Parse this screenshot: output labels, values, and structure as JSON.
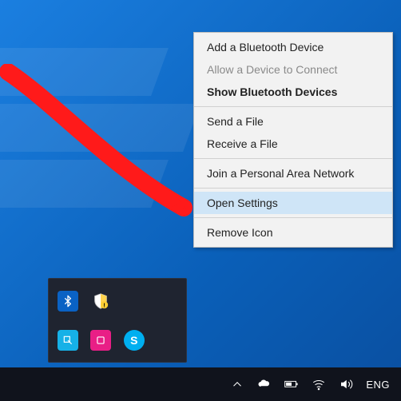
{
  "menu": {
    "add_device": "Add a Bluetooth Device",
    "allow_connect": "Allow a Device to Connect",
    "show_devices": "Show Bluetooth Devices",
    "send_file": "Send a File",
    "receive_file": "Receive a File",
    "join_pan": "Join a Personal Area Network",
    "open_settings": "Open Settings",
    "remove_icon": "Remove Icon"
  },
  "tray_popup": {
    "bluetooth_glyph": "*",
    "skype_letter": "S"
  },
  "taskbar": {
    "language": "ENG"
  }
}
